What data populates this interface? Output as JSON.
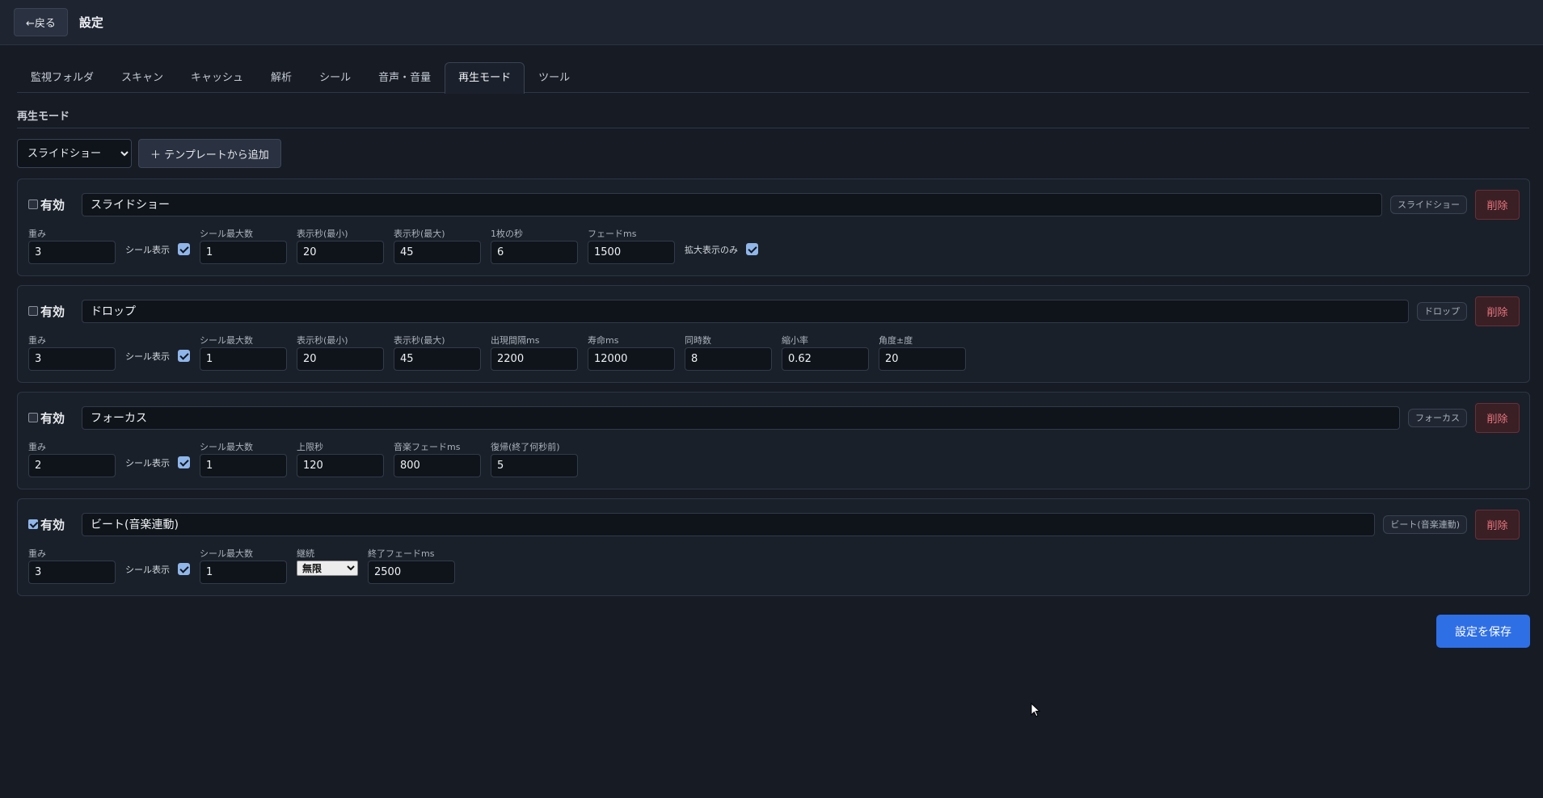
{
  "header": {
    "back_label": "←戻る",
    "title": "設定"
  },
  "tabs": [
    "監視フォルダ",
    "スキャン",
    "キャッシュ",
    "解析",
    "シール",
    "音声・音量",
    "再生モード",
    "ツール"
  ],
  "active_tab": "再生モード",
  "section_title": "再生モード",
  "toolbar": {
    "select_value": "スライドショー",
    "add_template_label": "＋ テンプレートから追加"
  },
  "common": {
    "enabled_label": "有効",
    "delete_label": "削除"
  },
  "modes": [
    {
      "enabled": false,
      "name": "スライドショー",
      "type_tag": "スライドショー",
      "fields": [
        {
          "label": "重み",
          "value": "3"
        },
        {
          "label": "シール表示",
          "checkbox": true
        },
        {
          "label": "シール最大数",
          "value": "1"
        },
        {
          "label": "表示秒(最小)",
          "value": "20"
        },
        {
          "label": "表示秒(最大)",
          "value": "45"
        },
        {
          "label": "1枚の秒",
          "value": "6"
        },
        {
          "label": "フェードms",
          "value": "1500"
        },
        {
          "label": "拡大表示のみ",
          "checkbox": true
        }
      ]
    },
    {
      "enabled": false,
      "name": "ドロップ",
      "type_tag": "ドロップ",
      "fields": [
        {
          "label": "重み",
          "value": "3"
        },
        {
          "label": "シール表示",
          "checkbox": true
        },
        {
          "label": "シール最大数",
          "value": "1"
        },
        {
          "label": "表示秒(最小)",
          "value": "20"
        },
        {
          "label": "表示秒(最大)",
          "value": "45"
        },
        {
          "label": "出現間隔ms",
          "value": "2200"
        },
        {
          "label": "寿命ms",
          "value": "12000"
        },
        {
          "label": "同時数",
          "value": "8"
        },
        {
          "label": "縮小率",
          "value": "0.62"
        },
        {
          "label": "角度±度",
          "value": "20"
        }
      ]
    },
    {
      "enabled": false,
      "name": "フォーカス",
      "type_tag": "フォーカス",
      "fields": [
        {
          "label": "重み",
          "value": "2"
        },
        {
          "label": "シール表示",
          "checkbox": true
        },
        {
          "label": "シール最大数",
          "value": "1"
        },
        {
          "label": "上限秒",
          "value": "120"
        },
        {
          "label": "音楽フェードms",
          "value": "800"
        },
        {
          "label": "復帰(終了何秒前)",
          "value": "5"
        }
      ]
    },
    {
      "enabled": true,
      "name": "ビート(音楽連動)",
      "type_tag": "ビート(音楽連動)",
      "fields": [
        {
          "label": "重み",
          "value": "3"
        },
        {
          "label": "シール表示",
          "checkbox": true
        },
        {
          "label": "シール最大数",
          "value": "1"
        },
        {
          "label": "継続",
          "select": "無限"
        },
        {
          "label": "終了フェードms",
          "value": "2500"
        }
      ]
    }
  ],
  "save_label": "設定を保存"
}
